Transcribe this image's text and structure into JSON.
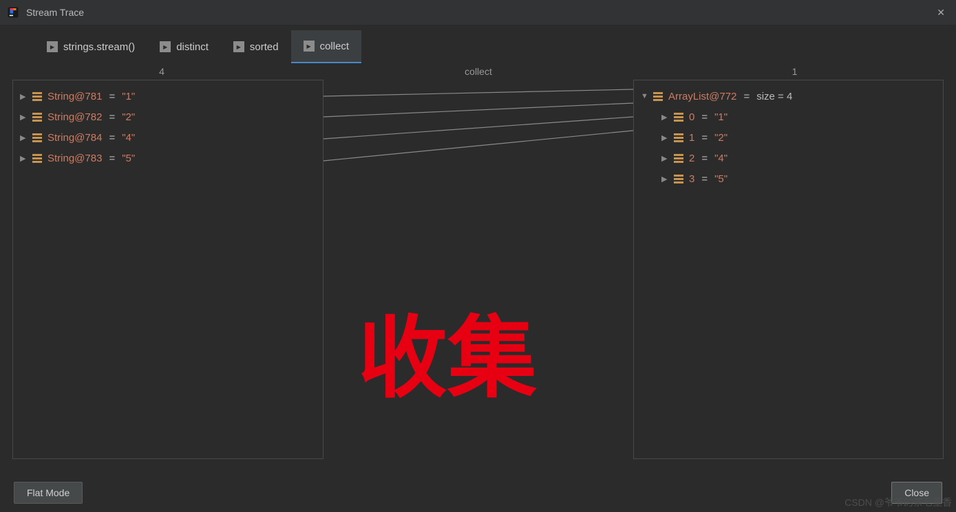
{
  "window": {
    "title": "Stream Trace"
  },
  "tabs": [
    {
      "label": "strings.stream()",
      "active": false
    },
    {
      "label": "distinct",
      "active": false
    },
    {
      "label": "sorted",
      "active": false
    },
    {
      "label": "collect",
      "active": true
    }
  ],
  "columns": {
    "left_count": "4",
    "mid_label": "collect",
    "right_count": "1"
  },
  "left_items": [
    {
      "name": "String@781",
      "value": "\"1\""
    },
    {
      "name": "String@782",
      "value": "\"2\""
    },
    {
      "name": "String@784",
      "value": "\"4\""
    },
    {
      "name": "String@783",
      "value": "\"5\""
    }
  ],
  "right_root": {
    "name": "ArrayList@772",
    "suffix": "size = 4"
  },
  "right_children": [
    {
      "key": "0",
      "value": "\"1\""
    },
    {
      "key": "1",
      "value": "\"2\""
    },
    {
      "key": "2",
      "value": "\"4\""
    },
    {
      "key": "3",
      "value": "\"5\""
    }
  ],
  "overlay": "收集",
  "footer": {
    "flat_mode": "Flat Mode",
    "close": "Close"
  },
  "watermark": "CSDN @爷爷的茶七里香",
  "equals": "="
}
